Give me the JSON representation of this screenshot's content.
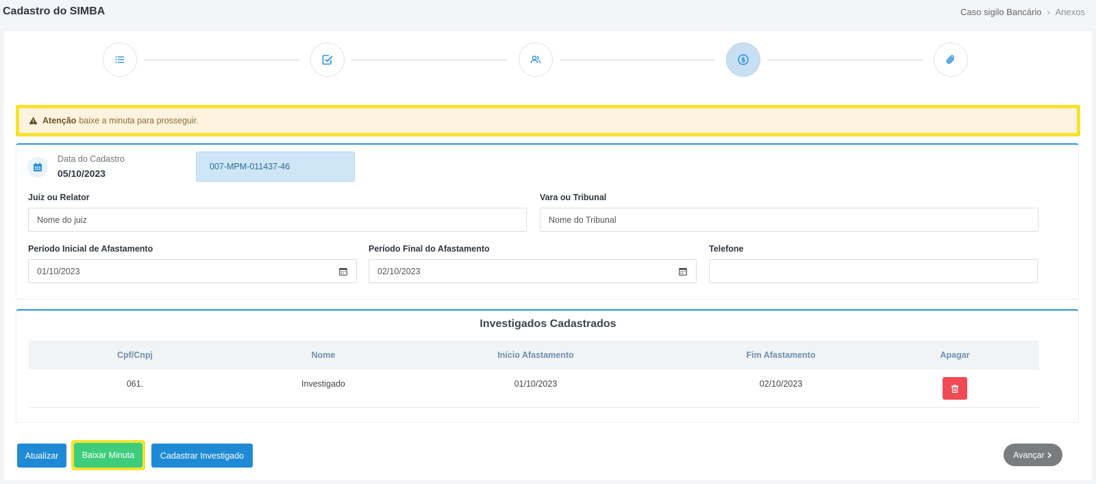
{
  "header": {
    "title": "Cadastro do SIMBA",
    "breadcrumb": [
      "Caso sigilo Bancário",
      "Anexos"
    ],
    "breadcrumb_sep": "›"
  },
  "stepper": {
    "steps": [
      {
        "icon": "list-icon"
      },
      {
        "icon": "checkbox-icon"
      },
      {
        "icon": "users-icon"
      },
      {
        "icon": "dollar-circle-icon",
        "active": true
      },
      {
        "icon": "paperclip-icon"
      }
    ]
  },
  "alert": {
    "strong": "Atenção",
    "message": "baixe a minuta para prosseguir."
  },
  "form": {
    "date_label": "Data do Cadastro",
    "date_value": "05/10/2023",
    "protocol": "007-MPM-011437-46",
    "judge_label": "Juiz ou Relator",
    "judge_placeholder": "Nome do juiz",
    "court_label": "Vara ou Tribunal",
    "court_placeholder": "Nome do Tribunal",
    "start_label": "Período Inicial de Afastamento",
    "start_value": "01/10/2023",
    "end_label": "Período Final do Afastamento",
    "end_value": "02/10/2023",
    "phone_label": "Telefone",
    "phone_value": ""
  },
  "table": {
    "title": "Investigados Cadastrados",
    "columns": [
      "Cpf/Cnpj",
      "Nome",
      "Início Afastamento",
      "Fim Afastamento",
      "Apagar"
    ],
    "rows": [
      {
        "cpf": "061.",
        "nome": "Investigado",
        "inicio": "01/10/2023",
        "fim": "02/10/2023"
      }
    ]
  },
  "buttons": {
    "update": "Atualizar",
    "download": "Baixar Minuta",
    "register": "Cadastrar Investigado",
    "next": "Avançar"
  },
  "colors": {
    "primary": "#1e8ad6",
    "success": "#3dcd7b",
    "danger": "#ef4a55",
    "highlight": "#f6e22a"
  }
}
